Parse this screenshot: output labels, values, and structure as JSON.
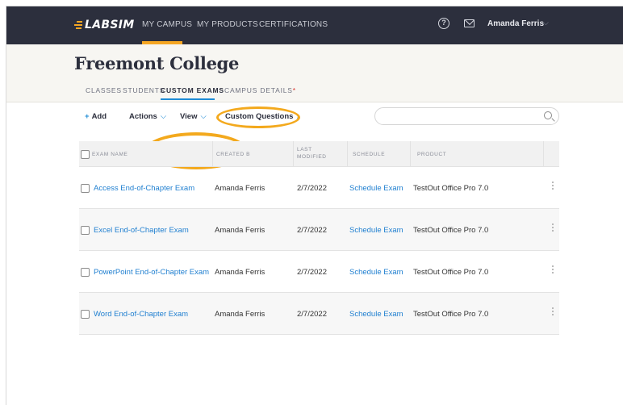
{
  "nav": {
    "logo": "LABSIM",
    "links": [
      "MY CAMPUS",
      "MY PRODUCTS",
      "CERTIFICATIONS"
    ],
    "help_icon": "question-circle",
    "help_glyph": "?",
    "mail_icon": "envelope",
    "user_name": "Amanda Ferris",
    "user_caret": "⌵"
  },
  "header": {
    "title": "Freemont College",
    "tabs": [
      "CLASSES",
      "STUDENTS",
      "CUSTOM EXAMS",
      "CAMPUS DETAILS"
    ],
    "active_tab": "CUSTOM EXAMS",
    "tab_marker": "*"
  },
  "toolbar": {
    "add_plus": "+",
    "add_label": "Add",
    "actions_label": "Actions",
    "view_label": "View",
    "caret": "⌵",
    "custom_questions_label": "Custom Questions",
    "custom_questions_chevron": "›",
    "search_placeholder": ""
  },
  "table": {
    "headers": {
      "name": "EXAM NAME",
      "created_by": "CREATED B",
      "last_modified_1": "LAST",
      "last_modified_2": "MODIFIED",
      "schedule": "SCHEDULE",
      "product": "PRODUCT"
    },
    "rows": [
      {
        "name": "Access End-of-Chapter Exam",
        "created_by": "Amanda Ferris",
        "modified": "2/7/2022",
        "schedule": "Schedule Exam",
        "product": "TestOut Office Pro 7.0"
      },
      {
        "name": "Excel End-of-Chapter Exam",
        "created_by": "Amanda Ferris",
        "modified": "2/7/2022",
        "schedule": "Schedule Exam",
        "product": "TestOut Office Pro 7.0"
      },
      {
        "name": "PowerPoint End-of-Chapter Exam",
        "created_by": "Amanda Ferris",
        "modified": "2/7/2022",
        "schedule": "Schedule Exam",
        "product": "TestOut Office Pro 7.0"
      },
      {
        "name": "Word End-of-Chapter Exam",
        "created_by": "Amanda Ferris",
        "modified": "2/7/2022",
        "schedule": "Schedule Exam",
        "product": "TestOut Office Pro 7.0"
      }
    ]
  },
  "colors": {
    "nav_bg": "#2c2f3d",
    "accent_orange": "#f5a623",
    "link_blue": "#1f7fd0",
    "header_bg": "#f7f6f2"
  }
}
